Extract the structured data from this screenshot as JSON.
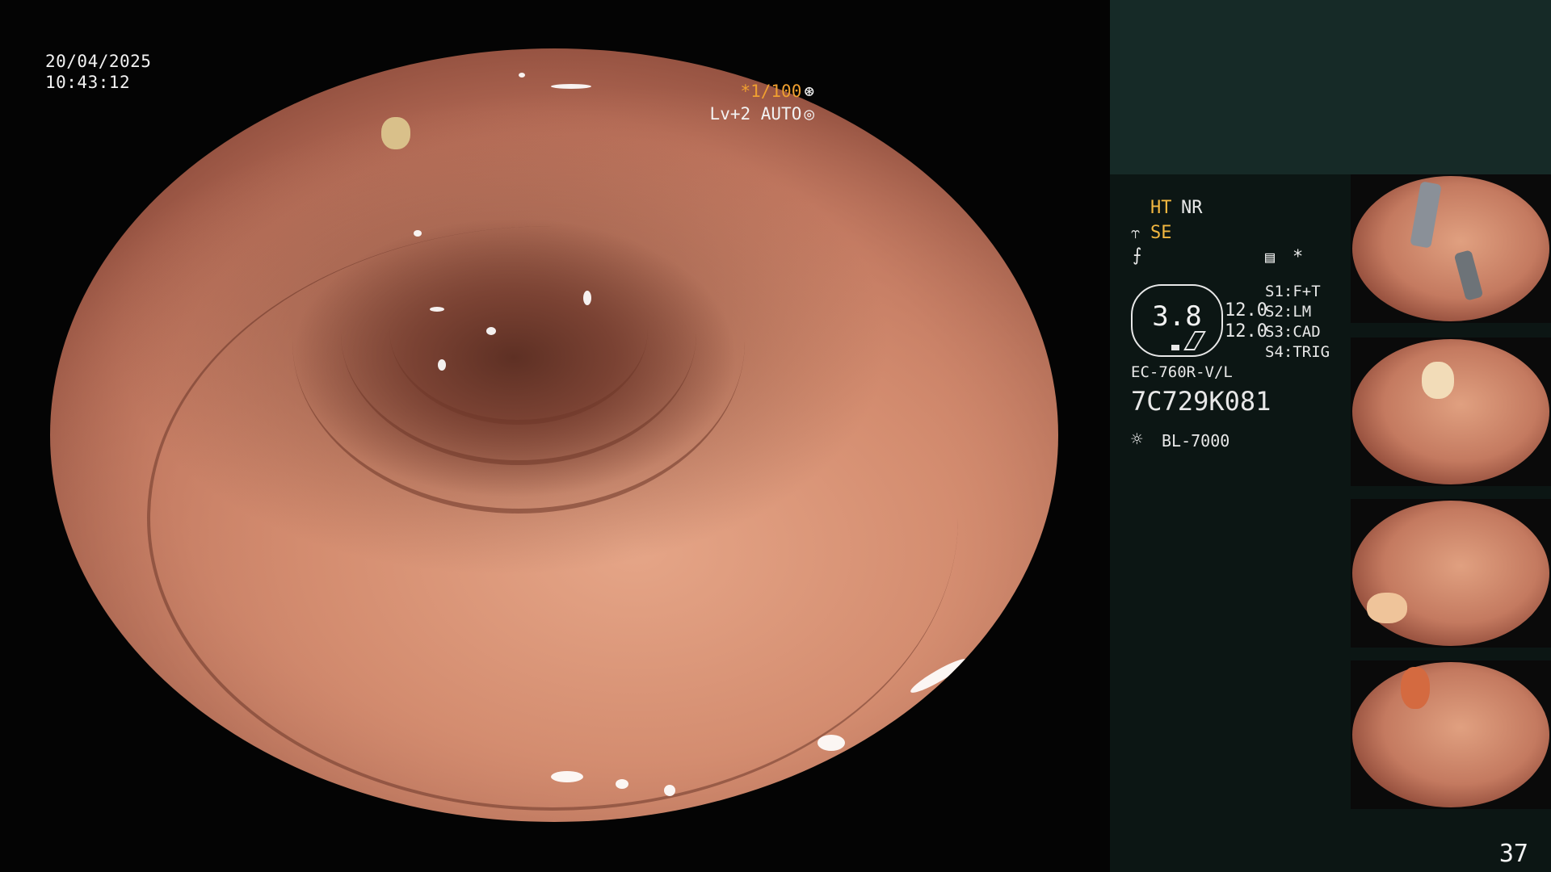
{
  "overlay": {
    "date": "20/04/2025",
    "time": "10:43:12",
    "shutter": "*1/100",
    "shutter_icon": "aperture-icon",
    "level": "Lv+2 AUTO",
    "level_icon": "auto-exposure-icon"
  },
  "panel": {
    "ht_label": "HT",
    "nr_label": "NR",
    "se_label": "SE",
    "gauge_value": "3.8",
    "value_top": "12.0",
    "value_bottom": "12.0",
    "switches": [
      "S1:F+T",
      "S2:LM",
      "S3:CAD",
      "S4:TRIG"
    ],
    "scope_model": "EC-760R-V/L",
    "serial": "7C729K081",
    "light_source": "BL-7000",
    "star": "*"
  },
  "page_number": "37",
  "colors": {
    "accent_yellow": "#f2b740",
    "panel_bg": "#0c1614",
    "panel_top_bg": "#162a27"
  }
}
